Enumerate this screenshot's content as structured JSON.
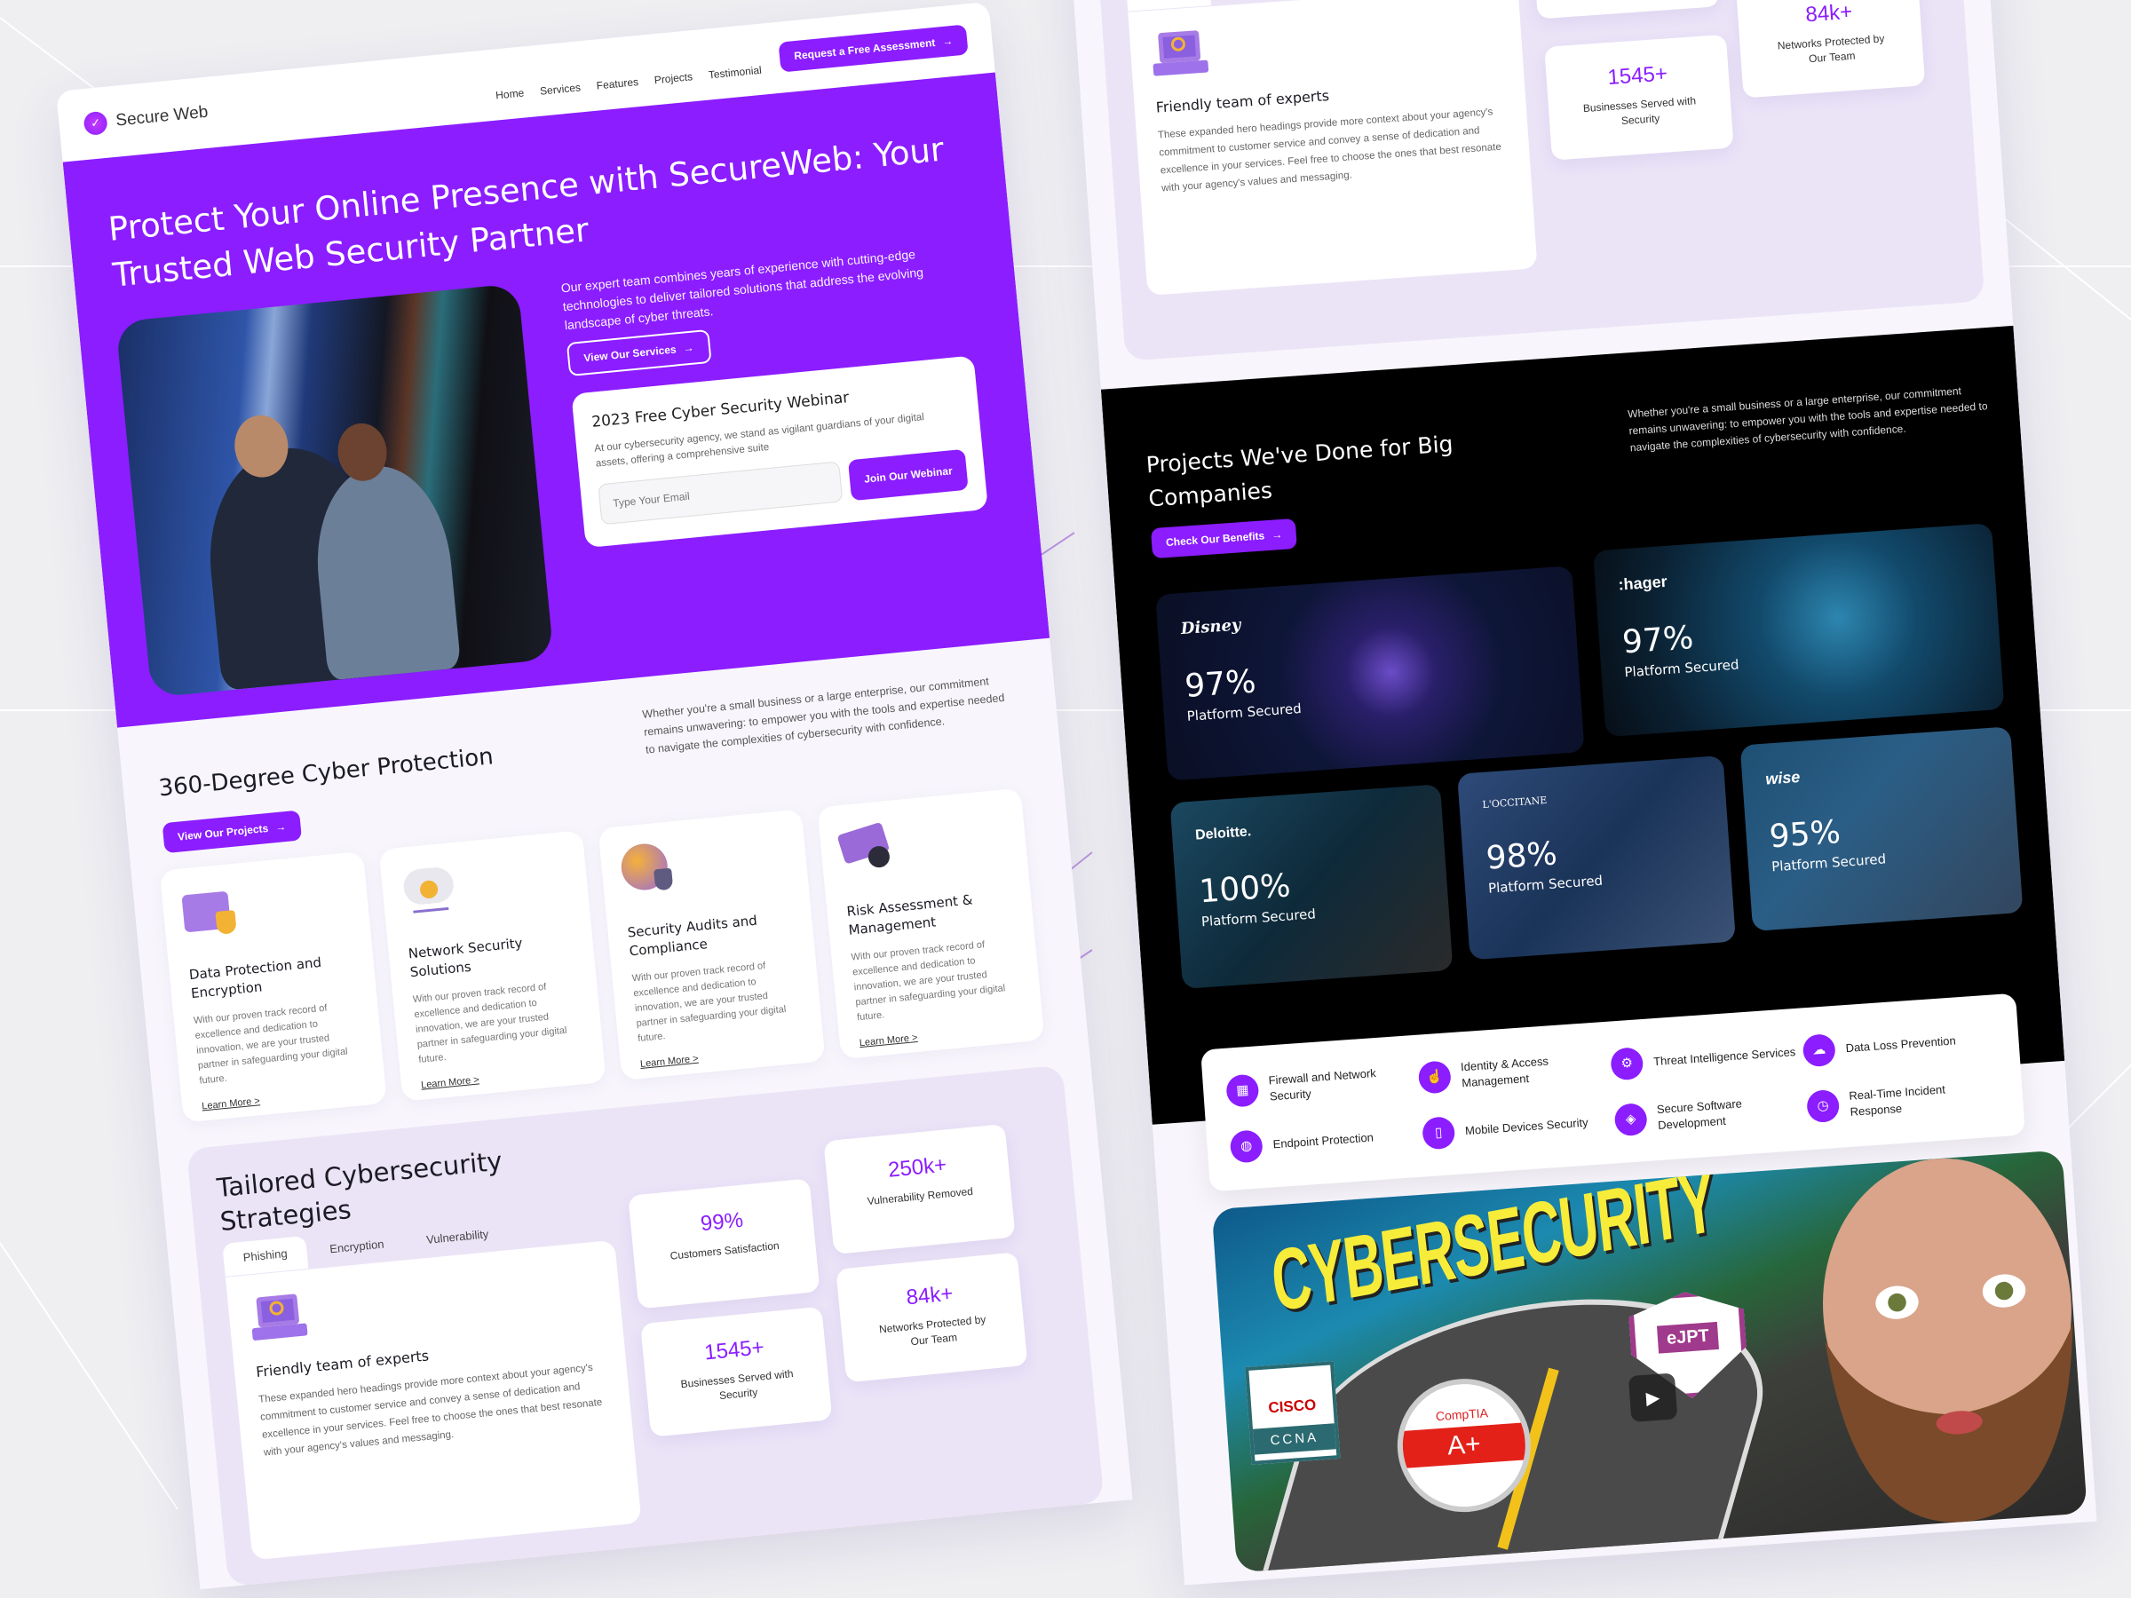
{
  "brand": {
    "name": "Secure Web",
    "accent": "#8b1dff",
    "logo_icon": "shield-check-icon"
  },
  "nav": {
    "links": [
      "Home",
      "Services",
      "Features",
      "Projects",
      "Testimonial"
    ],
    "cta": "Request a Free Assessment"
  },
  "hero": {
    "title": "Protect Your Online Presence with SecureWeb: Your Trusted Web Security Partner",
    "description": "Our expert team combines years of experience with cutting-edge technologies to deliver tailored solutions that address the evolving landscape of cyber threats.",
    "button": "View Our Services",
    "webinar": {
      "title": "2023 Free Cyber Security Webinar",
      "text": "At our cybersecurity agency, we stand as vigilant guardians of your digital assets, offering a comprehensive suite",
      "email_placeholder": "Type Your Email",
      "button": "Join Our Webinar"
    }
  },
  "protection": {
    "title": "360-Degree Cyber Protection",
    "description": "Whether you're a small business or a large enterprise, our commitment remains unwavering: to empower you with the tools and expertise needed to navigate the complexities of cybersecurity with confidence.",
    "button": "View Our Projects",
    "cards": [
      {
        "title": "Data Protection and Encryption",
        "text": "With our proven track record of excellence and dedication to innovation, we are your trusted partner in safeguarding your digital future.",
        "link": "Learn More >",
        "icon": "folder-shield-icon"
      },
      {
        "title": "Network Security Solutions",
        "text": "With our proven track record of excellence and dedication to innovation, we are your trusted partner in safeguarding your digital future.",
        "link": "Learn More >",
        "icon": "cloud-lock-icon"
      },
      {
        "title": "Security Audits and Compliance",
        "text": "With our proven track record of excellence and dedication to innovation, we are your trusted partner in safeguarding your digital future.",
        "link": "Learn More >",
        "icon": "globe-shield-icon"
      },
      {
        "title": "Risk Assessment & Management",
        "text": "With our proven track record of excellence and dedication to innovation, we are your trusted partner in safeguarding your digital future.",
        "link": "Learn More >",
        "icon": "card-lock-icon"
      }
    ]
  },
  "tailored": {
    "title": "Tailored Cybersecurity Strategies",
    "tabs": [
      "Phishing",
      "Encryption",
      "Vulnerability"
    ],
    "active_tab": "Phishing",
    "card": {
      "title": "Friendly team of experts",
      "text": "These expanded hero headings provide more context about your agency's commitment to customer service and convey a sense of dedication and excellence in your services. Feel free to choose the ones that best resonate with your agency's values and messaging."
    },
    "stats": [
      {
        "value": "99%",
        "label": "Customers Satisfaction"
      },
      {
        "value": "250k+",
        "label": "Vulnerability Removed"
      },
      {
        "value": "1545+",
        "label": "Businesses Served with Security"
      },
      {
        "value": "84k+",
        "label": "Networks Protected by Our Team"
      }
    ]
  },
  "projects": {
    "title": "Projects We've Done for Big Companies",
    "description": "Whether you're a small business or a large enterprise, our commitment remains unwavering: to empower you with the tools and expertise needed to navigate the complexities of cybersecurity with confidence.",
    "button": "Check Our Benefits",
    "items": [
      {
        "company": "Disney",
        "value": "97%",
        "label": "Platform Secured"
      },
      {
        "company": ":hager",
        "value": "97%",
        "label": "Platform Secured"
      },
      {
        "company": "Deloitte.",
        "value": "100%",
        "label": "Platform Secured"
      },
      {
        "company": "L'OCCITANE",
        "value": "98%",
        "label": "Platform Secured"
      },
      {
        "company": "wise",
        "value": "95%",
        "label": "Platform Secured"
      }
    ]
  },
  "features": [
    {
      "label": "Firewall and Network Security",
      "icon": "firewall-icon"
    },
    {
      "label": "Identity & Access Management",
      "icon": "fingerprint-icon"
    },
    {
      "label": "Threat Intelligence Services",
      "icon": "threat-lock-icon"
    },
    {
      "label": "Data Loss Prevention",
      "icon": "cloud-data-icon"
    },
    {
      "label": "Endpoint Protection",
      "icon": "globe-network-icon"
    },
    {
      "label": "Mobile Devices Security",
      "icon": "mobile-check-icon"
    },
    {
      "label": "Secure Software Development",
      "icon": "shield-code-icon"
    },
    {
      "label": "Real-Time Incident Response",
      "icon": "clock-check-icon"
    }
  ],
  "video": {
    "headline": "CYBERSECURITY",
    "badges": {
      "cisco": "CISCO",
      "ccna": "CCNA",
      "comptia": "CompTIA",
      "aplus": "A+",
      "ejpt": "eJPT"
    }
  }
}
